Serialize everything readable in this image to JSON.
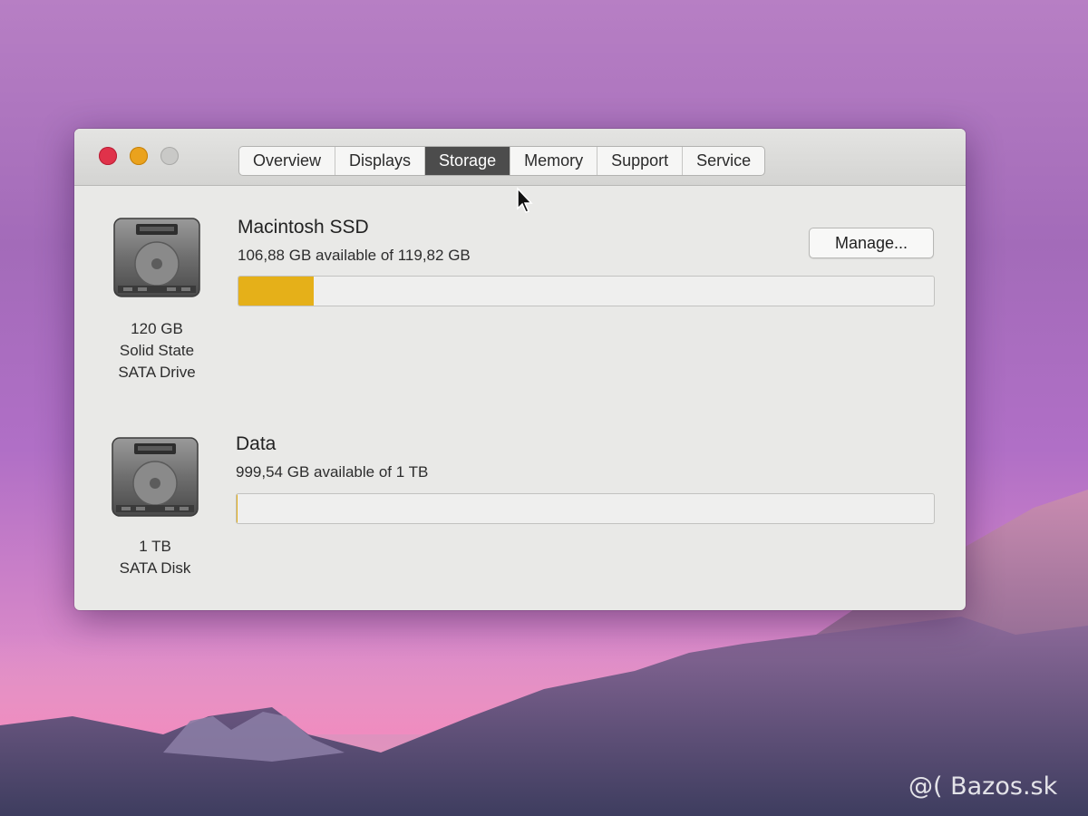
{
  "window": {
    "tabs": [
      {
        "label": "Overview"
      },
      {
        "label": "Displays"
      },
      {
        "label": "Storage",
        "active": true
      },
      {
        "label": "Memory"
      },
      {
        "label": "Support"
      },
      {
        "label": "Service"
      }
    ]
  },
  "disks": [
    {
      "icon": "hard-drive-icon",
      "caption": [
        "120 GB",
        "Solid State",
        "SATA Drive"
      ],
      "volume_name": "Macintosh SSD",
      "available_text": "106,88 GB available of 119,82 GB",
      "used_fraction": 0.108,
      "bar_color": "#e5b019",
      "manage_label": "Manage..."
    },
    {
      "icon": "hard-drive-icon",
      "caption": [
        "1 TB",
        "SATA Disk"
      ],
      "volume_name": "Data",
      "available_text": "999,54 GB available of 1 TB",
      "used_fraction": 0.0005,
      "bar_color": "#e5b019"
    }
  ],
  "watermark": "@( Bazos.sk",
  "colors": {
    "close": "#e0324a",
    "minimize": "#eaa21d",
    "zoom": "#c9c9c7",
    "active_tab": "#4c4c4c",
    "storage_fill": "#e5b019"
  }
}
